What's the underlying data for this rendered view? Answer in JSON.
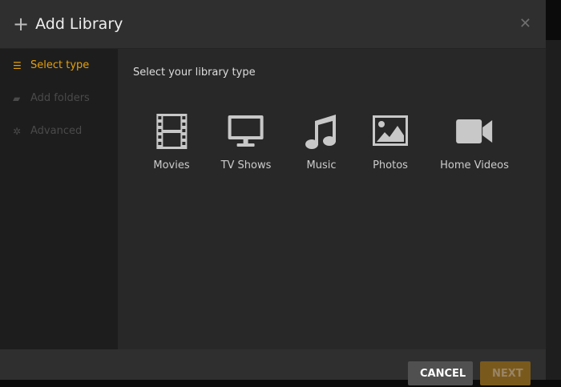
{
  "header": {
    "title": "Add Library"
  },
  "sidebar": {
    "items": [
      {
        "label": "Select type",
        "active": true
      },
      {
        "label": "Add folders",
        "active": false
      },
      {
        "label": "Advanced",
        "active": false
      }
    ]
  },
  "main": {
    "subtitle": "Select your library type",
    "types": [
      {
        "label": "Movies",
        "icon": "film-icon"
      },
      {
        "label": "TV Shows",
        "icon": "monitor-icon"
      },
      {
        "label": "Music",
        "icon": "music-note-icon"
      },
      {
        "label": "Photos",
        "icon": "image-icon"
      },
      {
        "label": "Home Videos",
        "icon": "video-camera-icon"
      }
    ]
  },
  "footer": {
    "cancel": "CANCEL",
    "next": "NEXT"
  },
  "colors": {
    "accent": "#e5a00d"
  }
}
